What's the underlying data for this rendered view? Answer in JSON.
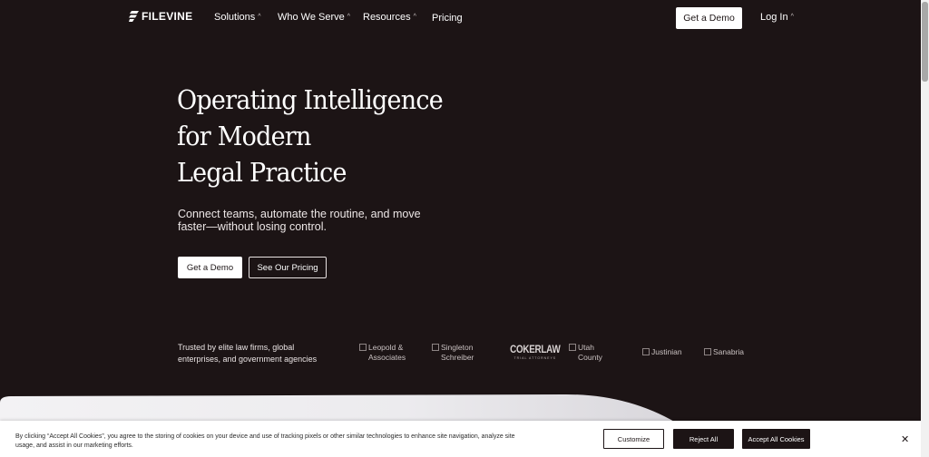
{
  "nav": {
    "brand": "FILEVINE",
    "items": [
      {
        "label": "Solutions",
        "caret": "^"
      },
      {
        "label": "Who We Serve",
        "caret": "^"
      },
      {
        "label": "Resources",
        "caret": "^"
      },
      {
        "label": "Pricing",
        "caret": ""
      }
    ],
    "cta": "Get a Demo",
    "login": "Log In",
    "login_caret": "^"
  },
  "hero": {
    "title_lines": [
      "Operating Intelligence",
      "for Modern",
      "Legal Practice"
    ],
    "subtitle": "Connect teams, automate the routine, and move faster—without losing control.",
    "primary_button": "Get a Demo",
    "secondary_button": "See Our Pricing"
  },
  "trusted": {
    "text": "Trusted by elite law firms, global enterprises, and government agencies",
    "logos": [
      {
        "alt": "Leopold & Associates"
      },
      {
        "alt": "Singleton Schreiber"
      },
      {
        "alt": "COKERLAW",
        "tagline": "TRIAL ATTORNEYS"
      },
      {
        "alt": "Utah County"
      },
      {
        "alt": "Justinian"
      },
      {
        "alt": "Sanabria"
      }
    ]
  },
  "cookie": {
    "text": "By clicking “Accept All Cookies”, you agree to the storing of cookies on your device and use of tracking pixels or other similar technologies to enhance site navigation, analyze site usage, and assist in our marketing efforts.",
    "customize": "Customize",
    "reject": "Reject All",
    "accept": "Accept All Cookies",
    "close": "✕"
  },
  "colors": {
    "background": "#1c1415",
    "panel": "#e9e7ea"
  }
}
